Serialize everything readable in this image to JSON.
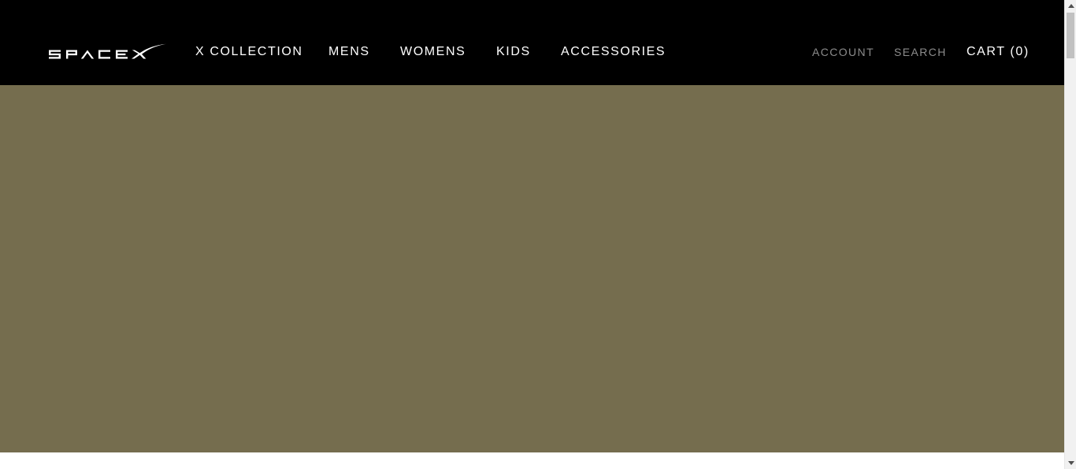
{
  "brand": {
    "logo_icon": "spacex-wordmark-logo"
  },
  "nav": {
    "items": [
      {
        "label": "X COLLECTION"
      },
      {
        "label": "MENS"
      },
      {
        "label": "WOMENS"
      },
      {
        "label": "KIDS"
      },
      {
        "label": "ACCESSORIES"
      }
    ]
  },
  "utility": {
    "account_label": "ACCOUNT",
    "search_label": "SEARCH",
    "cart_label": "CART (0)"
  },
  "colors": {
    "header_bg": "#000000",
    "hero_bg": "#756d4e",
    "nav_text": "#ffffff",
    "utility_text": "#8c8c8c"
  },
  "icons": {
    "scroll_up": "chevron-up-icon",
    "scroll_down": "chevron-down-icon"
  }
}
